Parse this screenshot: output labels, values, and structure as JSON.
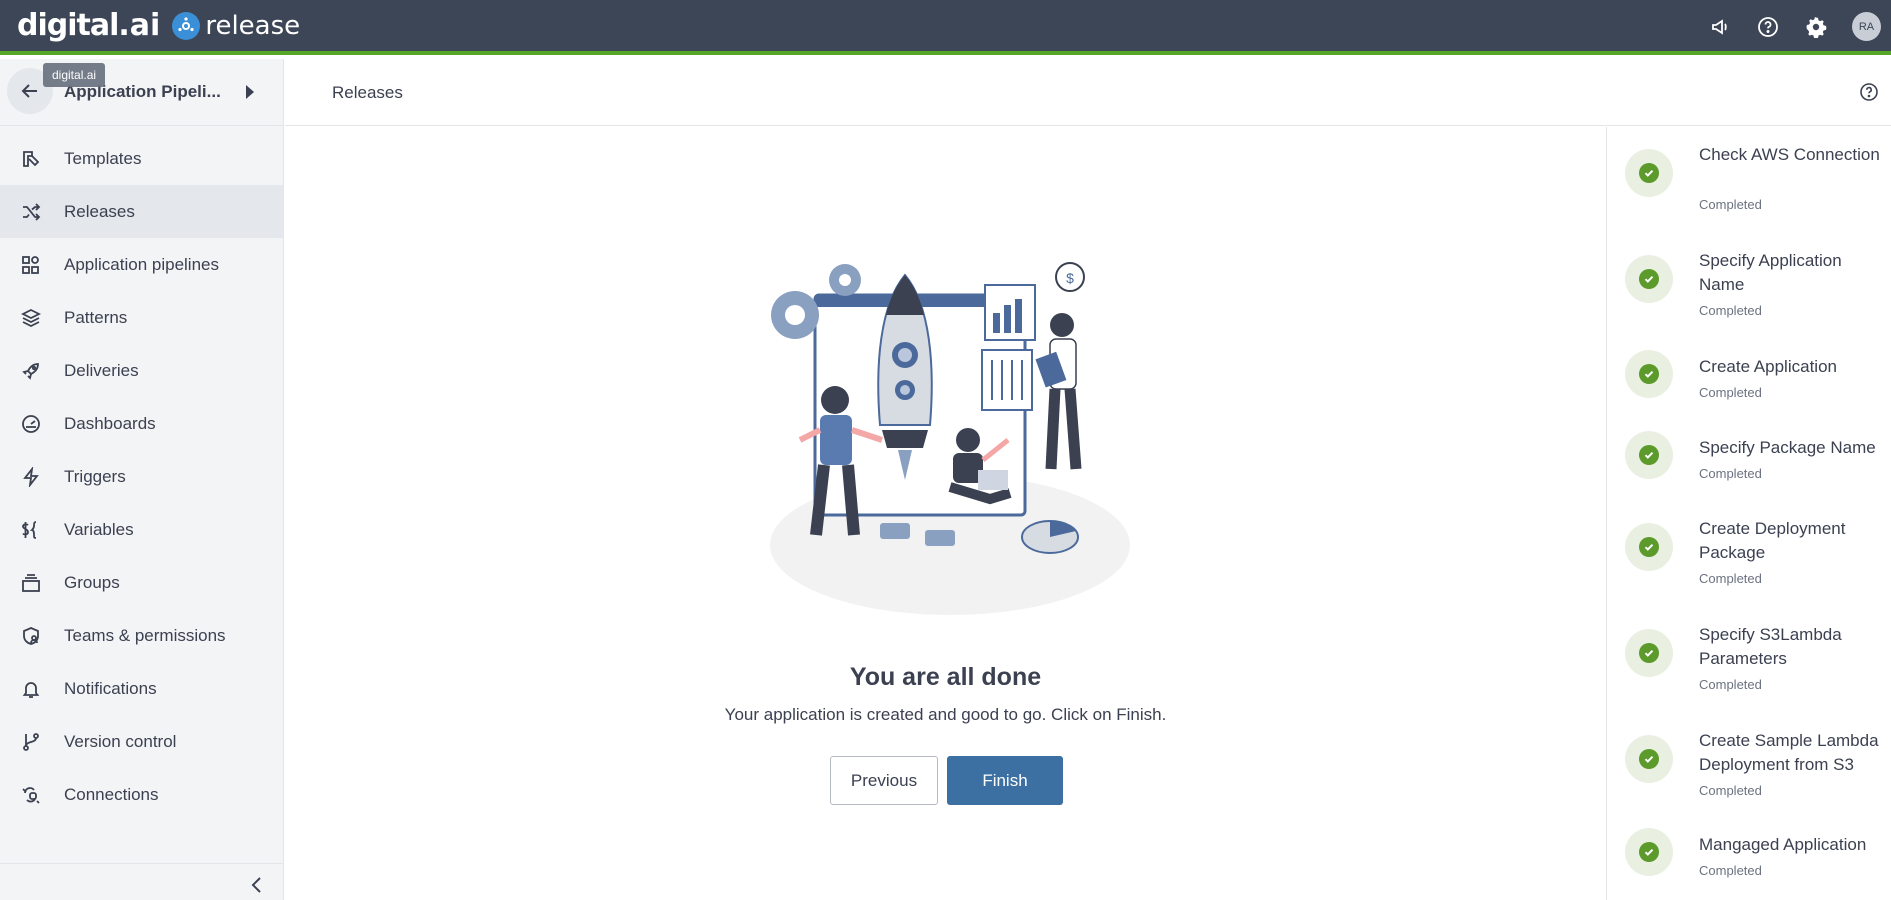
{
  "topbar": {
    "brand_digital": "digital",
    "brand_ai": ".ai",
    "brand_product": "release",
    "avatar_initials": "RA",
    "accent": "#56a629",
    "icons": [
      "megaphone-icon",
      "help-circle-icon",
      "gear-icon"
    ]
  },
  "sidebar": {
    "title": "Application Pipeli...",
    "tooltip": "digital.ai",
    "items": [
      {
        "label": "Templates",
        "icon": "template-icon"
      },
      {
        "label": "Releases",
        "icon": "shuffle-icon",
        "active": true
      },
      {
        "label": "Application pipelines",
        "icon": "grid-icon"
      },
      {
        "label": "Patterns",
        "icon": "layers-icon"
      },
      {
        "label": "Deliveries",
        "icon": "rocket-icon"
      },
      {
        "label": "Dashboards",
        "icon": "gauge-icon"
      },
      {
        "label": "Triggers",
        "icon": "bolt-icon"
      },
      {
        "label": "Variables",
        "icon": "variables-icon"
      },
      {
        "label": "Groups",
        "icon": "stack-icon"
      },
      {
        "label": "Teams & permissions",
        "icon": "shield-user-icon"
      },
      {
        "label": "Notifications",
        "icon": "bell-icon"
      },
      {
        "label": "Version control",
        "icon": "branch-icon"
      },
      {
        "label": "Connections",
        "icon": "connections-icon"
      }
    ]
  },
  "header": {
    "title": "Releases"
  },
  "main": {
    "done_title": "You are all done",
    "done_subtitle": "Your application is created and good to go. Click on Finish.",
    "previous_label": "Previous",
    "finish_label": "Finish",
    "primary_color": "#3c6fa2"
  },
  "steps": [
    {
      "name": "Check AWS Connection",
      "status": "Completed"
    },
    {
      "name": "Specify Application Name",
      "status": "Completed"
    },
    {
      "name": "Create Application",
      "status": "Completed"
    },
    {
      "name": "Specify Package Name",
      "status": "Completed"
    },
    {
      "name": "Create Deployment Package",
      "status": "Completed"
    },
    {
      "name": "Specify S3Lambda Parameters",
      "status": "Completed"
    },
    {
      "name": "Create Sample Lambda Deployment from S3",
      "status": "Completed"
    },
    {
      "name": "Mangaged Application",
      "status": "Completed"
    }
  ]
}
